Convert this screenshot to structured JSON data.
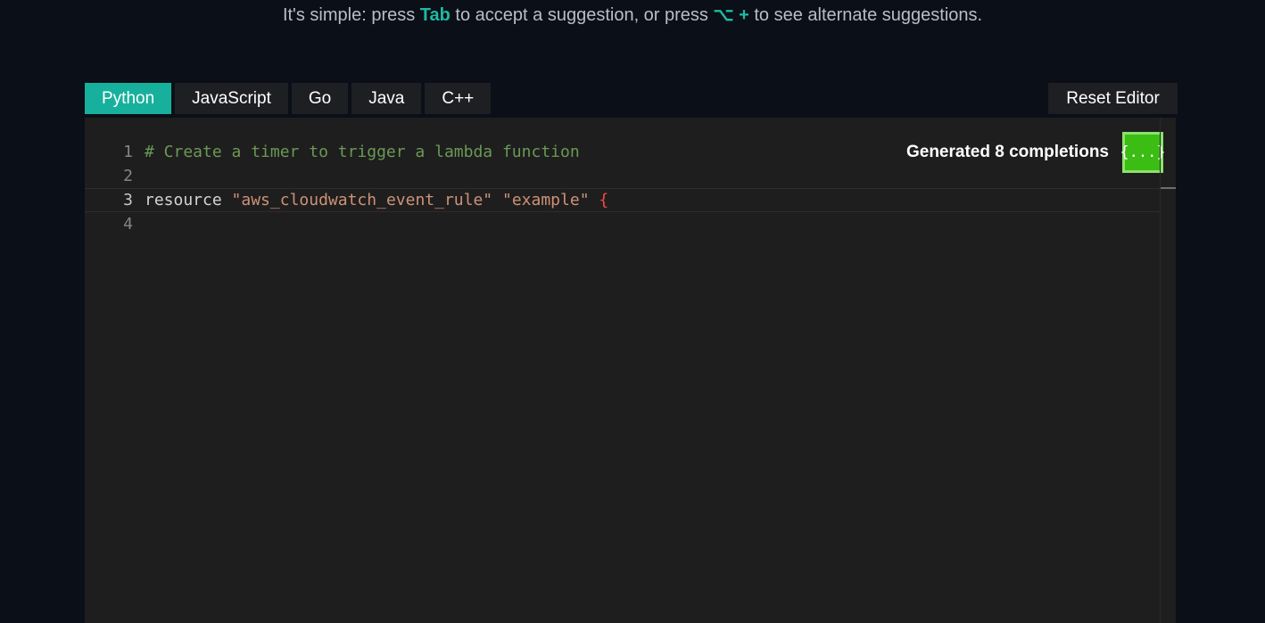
{
  "intro": {
    "prefix": "It's simple: press ",
    "tab_key": "Tab",
    "middle": " to accept a suggestion, or press ",
    "alt_key": "⌥ +",
    "suffix": " to see alternate suggestions."
  },
  "tabs": [
    {
      "label": "Python",
      "active": true
    },
    {
      "label": "JavaScript",
      "active": false
    },
    {
      "label": "Go",
      "active": false
    },
    {
      "label": "Java",
      "active": false
    },
    {
      "label": "C++",
      "active": false
    }
  ],
  "reset_label": "Reset Editor",
  "editor": {
    "lines": [
      {
        "number": "1",
        "comment": "# Create a timer to trigger a lambda function"
      },
      {
        "number": "2"
      },
      {
        "number": "3",
        "keyword": "resource ",
        "string1": "\"aws_cloudwatch_event_rule\"",
        "space": " ",
        "string2": "\"example\"",
        "space2": " ",
        "brace": "{"
      },
      {
        "number": "4"
      }
    ],
    "completions_label": "Generated 8 completions",
    "completions_icon": "{...}"
  },
  "colors": {
    "accent": "#17b09c",
    "completions_button": "#3bbd14",
    "background": "#0b0f17",
    "editor": "#1e1e1e"
  }
}
